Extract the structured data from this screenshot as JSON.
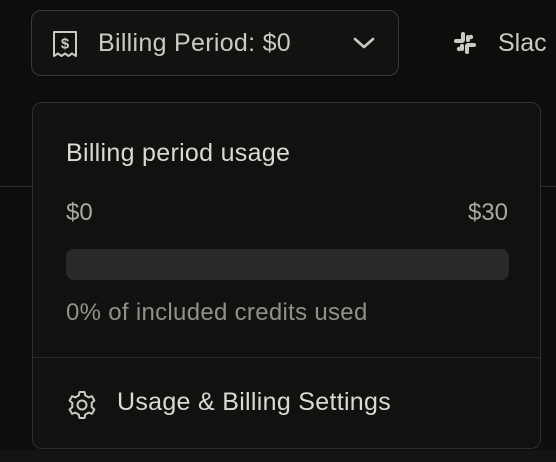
{
  "topbar": {
    "billing_button": {
      "label": "Billing Period: $0",
      "icon": "receipt-dollar-icon"
    },
    "slack_button": {
      "label": "Slac",
      "icon": "slack-icon"
    }
  },
  "billing_dropdown": {
    "title": "Billing period usage",
    "min_label": "$0",
    "max_label": "$30",
    "progress_fraction": 0,
    "usage_text": "0% of included credits used",
    "settings_item": {
      "label": "Usage & Billing Settings",
      "icon": "gear-icon"
    }
  },
  "colors": {
    "background": "#0d0e0c",
    "panel": "#111210",
    "text_primary": "#d9d9d5",
    "text_muted": "#8f8f8b",
    "progress_track": "#28292b"
  }
}
